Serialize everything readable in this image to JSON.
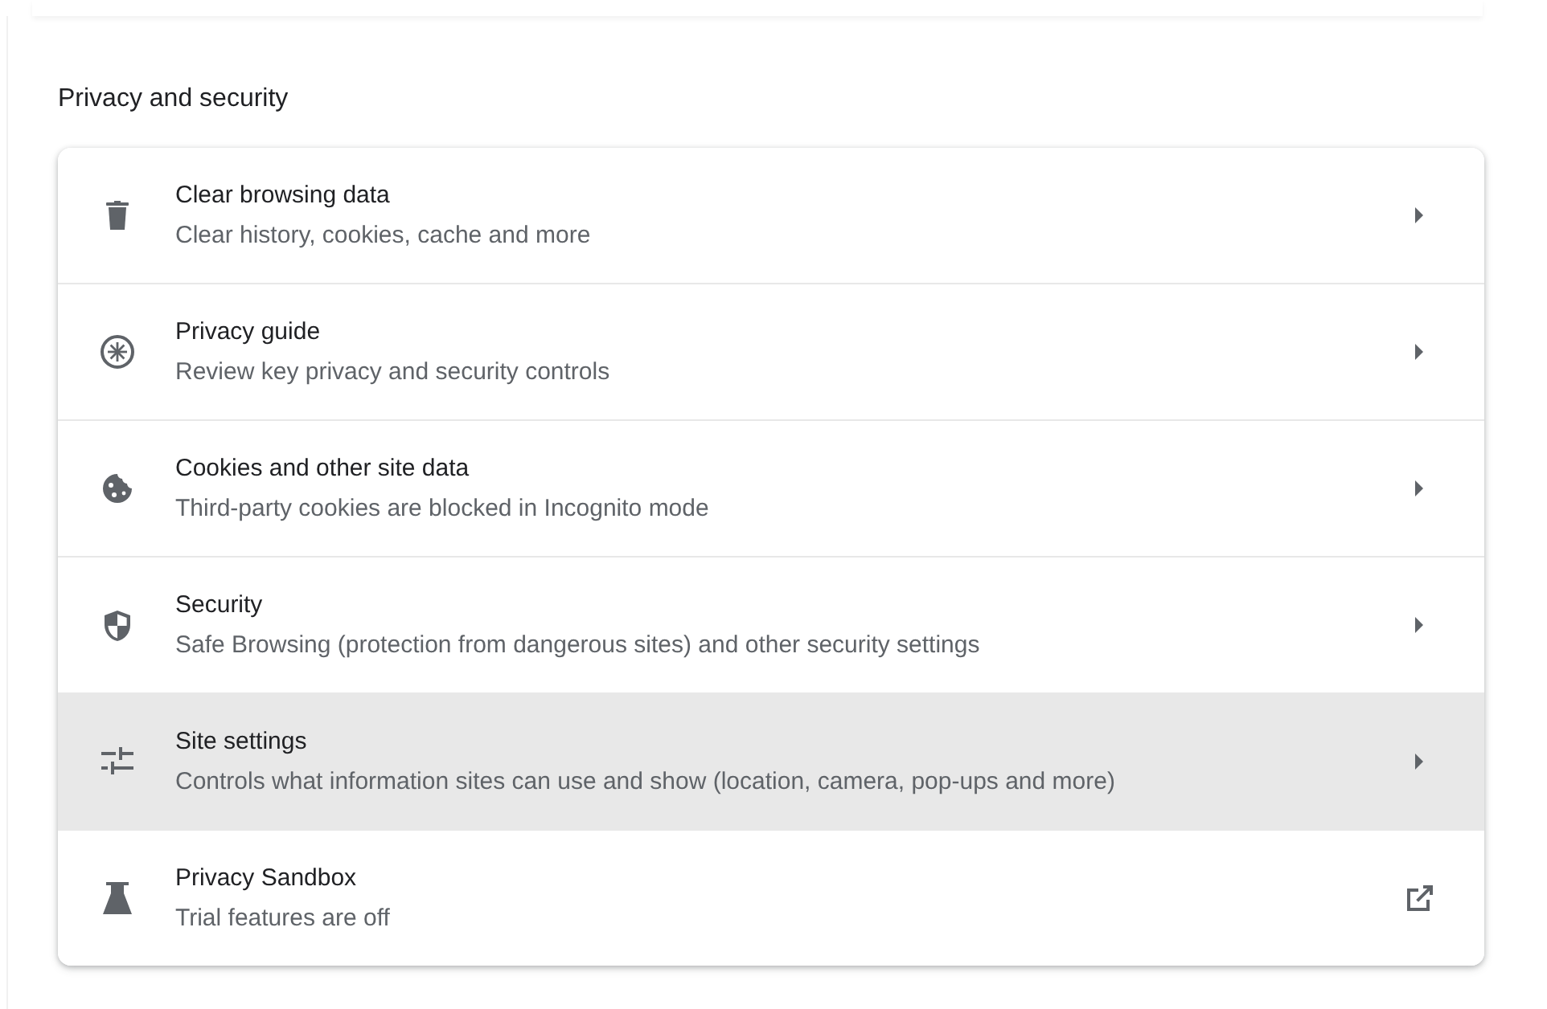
{
  "section": {
    "title": "Privacy and security"
  },
  "items": [
    {
      "kind": "subpage",
      "title": "Clear browsing data",
      "subtitle": "Clear history, cookies, cache and more",
      "selected": false
    },
    {
      "kind": "subpage",
      "title": "Privacy guide",
      "subtitle": "Review key privacy and security controls",
      "selected": false
    },
    {
      "kind": "subpage",
      "title": "Cookies and other site data",
      "subtitle": "Third-party cookies are blocked in Incognito mode",
      "selected": false
    },
    {
      "kind": "subpage",
      "title": "Security",
      "subtitle": "Safe Browsing (protection from dangerous sites) and other security settings",
      "selected": false
    },
    {
      "kind": "subpage",
      "title": "Site settings",
      "subtitle": "Controls what information sites can use and show (location, camera, pop-ups and more)",
      "selected": true
    },
    {
      "kind": "external",
      "title": "Privacy Sandbox",
      "subtitle": "Trial features are off",
      "selected": false
    }
  ]
}
